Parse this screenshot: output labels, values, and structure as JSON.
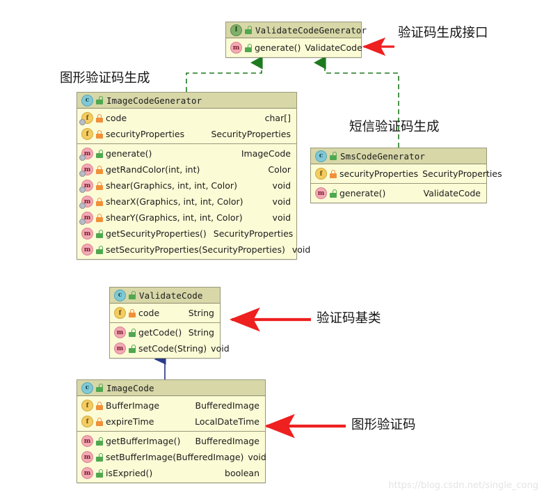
{
  "diagram": {
    "type": "uml-class-diagram",
    "background": "#ffffff",
    "watermark": "https://blog.csdn.net/single_cong",
    "colors": {
      "box_body": "#fbfbd6",
      "box_header": "#d7d7a8",
      "box_border": "#9a9a7a",
      "realization_arrow": "#1e7a1e",
      "generalization_arrow": "#2b3c8c",
      "annotation_arrow": "#ee2020",
      "icon_interface": "#7fb069",
      "icon_class": "#7fc9d6",
      "icon_field": "#f3cc62",
      "icon_method": "#f2a9b4",
      "lock_private": "#f0903a",
      "lock_public": "#4fa84f"
    }
  },
  "classes": {
    "validate_code_generator": {
      "stereotype": "interface",
      "icon": "interface-icon",
      "visibility_icon": "unlock-public-icon",
      "name": "ValidateCodeGenerator",
      "fields": [],
      "methods": [
        {
          "icon": "method-icon",
          "lock": "unlock-public-icon",
          "name": "generate()",
          "type": "ValidateCode"
        }
      ]
    },
    "image_code_generator": {
      "stereotype": "class",
      "icon": "class-icon",
      "visibility_icon": "unlock-public-icon",
      "name": "ImageCodeGenerator",
      "fields": [
        {
          "icon": "field-icon",
          "lock": "lock-private-icon",
          "name": "code",
          "type": "char[]",
          "decorated": true
        },
        {
          "icon": "field-icon",
          "lock": "lock-private-icon",
          "name": "securityProperties",
          "type": "SecurityProperties",
          "decorated": false
        }
      ],
      "methods": [
        {
          "icon": "method-icon",
          "lock": "unlock-public-icon",
          "name": "generate()",
          "type": "ImageCode",
          "decorated": true
        },
        {
          "icon": "method-icon",
          "lock": "lock-private-icon",
          "name": "getRandColor(int, int)",
          "type": "Color",
          "decorated": true
        },
        {
          "icon": "method-icon",
          "lock": "lock-private-icon",
          "name": "shear(Graphics, int, int, Color)",
          "type": "void",
          "decorated": true
        },
        {
          "icon": "method-icon",
          "lock": "lock-private-icon",
          "name": "shearX(Graphics, int, int, Color)",
          "type": "void",
          "decorated": true
        },
        {
          "icon": "method-icon",
          "lock": "lock-private-icon",
          "name": "shearY(Graphics, int, int, Color)",
          "type": "void",
          "decorated": true
        },
        {
          "icon": "method-icon",
          "lock": "unlock-public-icon",
          "name": "getSecurityProperties()",
          "type": "SecurityProperties",
          "decorated": false
        },
        {
          "icon": "method-icon",
          "lock": "unlock-public-icon",
          "name": "setSecurityProperties(SecurityProperties)",
          "type": "void",
          "decorated": false
        }
      ]
    },
    "sms_code_generator": {
      "stereotype": "class",
      "icon": "class-icon",
      "visibility_icon": "unlock-public-icon",
      "name": "SmsCodeGenerator",
      "fields": [
        {
          "icon": "field-icon",
          "lock": "lock-private-icon",
          "name": "securityProperties",
          "type": "SecurityProperties",
          "decorated": false
        }
      ],
      "methods": [
        {
          "icon": "method-icon",
          "lock": "unlock-public-icon",
          "name": "generate()",
          "type": "ValidateCode",
          "decorated": false
        }
      ]
    },
    "validate_code": {
      "stereotype": "class",
      "icon": "class-icon",
      "visibility_icon": "unlock-public-icon",
      "name": "ValidateCode",
      "fields": [
        {
          "icon": "field-icon",
          "lock": "lock-private-icon",
          "name": "code",
          "type": "String",
          "decorated": false
        }
      ],
      "methods": [
        {
          "icon": "method-icon",
          "lock": "unlock-public-icon",
          "name": "getCode()",
          "type": "String",
          "decorated": false
        },
        {
          "icon": "method-icon",
          "lock": "unlock-public-icon",
          "name": "setCode(String)",
          "type": "void",
          "decorated": false
        }
      ]
    },
    "image_code": {
      "stereotype": "class",
      "icon": "class-icon",
      "visibility_icon": "unlock-public-icon",
      "name": "ImageCode",
      "fields": [
        {
          "icon": "field-icon",
          "lock": "lock-private-icon",
          "name": "BufferImage",
          "type": "BufferedImage",
          "decorated": false
        },
        {
          "icon": "field-icon",
          "lock": "lock-private-icon",
          "name": "expireTime",
          "type": "LocalDateTime",
          "decorated": false
        }
      ],
      "methods": [
        {
          "icon": "method-icon",
          "lock": "unlock-public-icon",
          "name": "getBufferImage()",
          "type": "BufferedImage",
          "decorated": false
        },
        {
          "icon": "method-icon",
          "lock": "unlock-public-icon",
          "name": "setBufferImage(BufferedImage)",
          "type": "void",
          "decorated": false
        },
        {
          "icon": "method-icon",
          "lock": "unlock-public-icon",
          "name": "isExpried()",
          "type": "boolean",
          "decorated": false
        }
      ]
    }
  },
  "annotations": [
    {
      "id": "note-interface",
      "text": "验证码生成接口"
    },
    {
      "id": "note-image-gen",
      "text": "图形验证码生成"
    },
    {
      "id": "note-sms-gen",
      "text": "短信验证码生成"
    },
    {
      "id": "note-base-class",
      "text": "验证码基类"
    },
    {
      "id": "note-image-code",
      "text": "图形验证码"
    }
  ],
  "relationships": [
    {
      "from": "ImageCodeGenerator",
      "to": "ValidateCodeGenerator",
      "kind": "realization",
      "style": "dashed",
      "color": "#1e7a1e"
    },
    {
      "from": "SmsCodeGenerator",
      "to": "ValidateCodeGenerator",
      "kind": "realization",
      "style": "dashed",
      "color": "#1e7a1e"
    },
    {
      "from": "ImageCode",
      "to": "ValidateCode",
      "kind": "generalization",
      "style": "solid",
      "color": "#2b3c8c"
    }
  ]
}
